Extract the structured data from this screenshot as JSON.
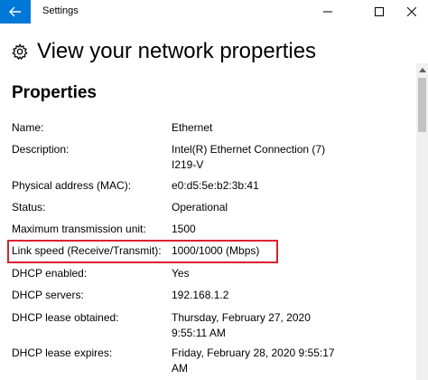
{
  "window": {
    "title": "Settings",
    "back_icon": "arrow-left-icon",
    "minimize_icon": "minimize-icon",
    "maximize_icon": "maximize-icon",
    "close_icon": "close-icon",
    "accent": "#0078d7"
  },
  "header": {
    "icon": "gear-icon",
    "title": "View your network properties"
  },
  "section": {
    "title": "Properties"
  },
  "properties": [
    {
      "label": "Name:",
      "value": "Ethernet"
    },
    {
      "label": "Description:",
      "value_lines": [
        "Intel(R) Ethernet Connection (7)",
        "I219-V"
      ]
    },
    {
      "label": "Physical address (MAC):",
      "value": "e0:d5:5e:b2:3b:41"
    },
    {
      "label": "Status:",
      "value": "Operational"
    },
    {
      "label": "Maximum transmission unit:",
      "value": "1500"
    },
    {
      "label": "Link speed (Receive/Transmit):",
      "value": "1000/1000 (Mbps)",
      "highlighted": true
    },
    {
      "label": "DHCP enabled:",
      "value": "Yes"
    },
    {
      "label": "DHCP servers:",
      "value": "192.168.1.2"
    },
    {
      "label": "DHCP lease obtained:",
      "value_lines": [
        "Thursday, February 27, 2020",
        "9:55:11 AM"
      ]
    },
    {
      "label": "DHCP lease expires:",
      "value_lines": [
        "Friday, February 28, 2020 9:55:17",
        "AM"
      ]
    }
  ],
  "highlight_color": "#d9232e"
}
